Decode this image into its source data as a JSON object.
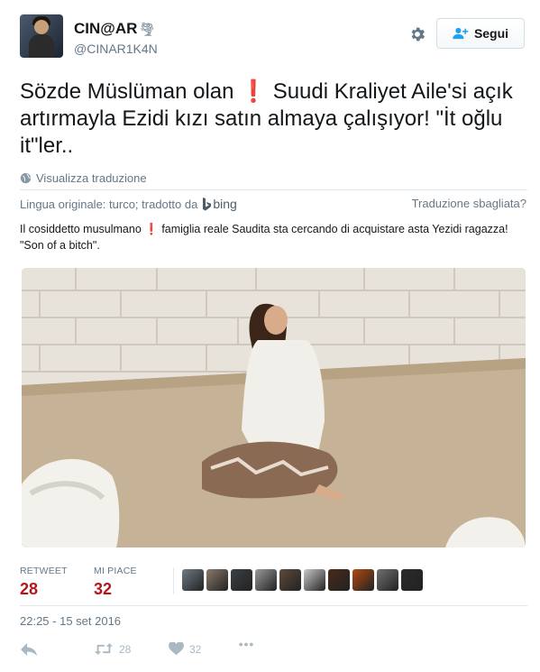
{
  "user": {
    "name": "CIN@AR",
    "name_icon": "tornado-icon",
    "handle": "@CINAR1K4N"
  },
  "header": {
    "settings_icon": "gear-icon",
    "follow_label": "Segui",
    "follow_icon": "follow-user-icon"
  },
  "tweet": {
    "text_before": "Sözde Müslüman olan ",
    "exclamation": "❗",
    "text_after": " Suudi Kraliyet Aile'si açık artırmayla Ezidi kızı satın almaya çalışıyor! \"İt oğlu it\"ler.."
  },
  "translation": {
    "link_label": "Visualizza traduzione",
    "link_icon": "globe-icon",
    "original_lang": "Lingua originale: turco; tradotto da",
    "provider": "bing",
    "wrong_label": "Traduzione sbagliata?",
    "text_before": "Il cosiddetto musulmano ",
    "exclamation": "❗",
    "text_after": " famiglia reale Saudita sta cercando di acquistare asta Yezidi ragazza! \"Son of a bitch\"."
  },
  "stats": {
    "retweet_label": "RETWEET",
    "retweet_count": "28",
    "likes_label": "MI PIACE",
    "likes_count": "32"
  },
  "likers": [
    {
      "color": "#6f7b86"
    },
    {
      "color": "#8a7a6c"
    },
    {
      "color": "#3b3f45"
    },
    {
      "color": "#9a9a9a"
    },
    {
      "color": "#5d4a3a"
    },
    {
      "color": "#c9c9c9"
    },
    {
      "color": "#4a2a1a"
    },
    {
      "color": "#b04a12"
    },
    {
      "color": "#707070"
    },
    {
      "color": "#2b2b2b"
    }
  ],
  "timestamp": "22:25 - 15 set 2016",
  "actions": {
    "reply_icon": "reply-icon",
    "retweet_icon": "retweet-icon",
    "retweet_count": "28",
    "like_icon": "heart-icon",
    "like_count": "32",
    "more_icon": "more-icon"
  },
  "colors": {
    "accent": "#1da1f2",
    "stat_number": "#b4161b",
    "muted": "#657786"
  }
}
